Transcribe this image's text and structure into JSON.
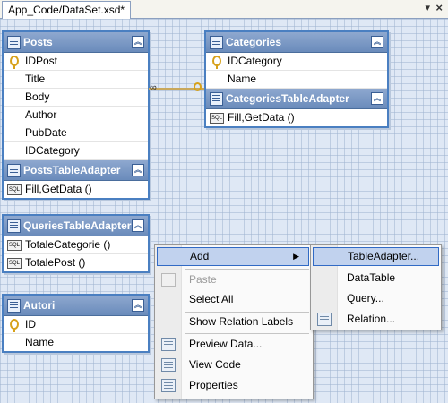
{
  "tab": {
    "title": "App_Code/DataSet.xsd*",
    "menu_icon": "chevron-down-icon",
    "close_icon": "close-icon"
  },
  "posts": {
    "title": "Posts",
    "columns": [
      "IDPost",
      "Title",
      "Body",
      "Author",
      "PubDate",
      "IDCategory"
    ],
    "adapter": {
      "title": "PostsTableAdapter",
      "methods": [
        "Fill,GetData ()"
      ]
    }
  },
  "categories": {
    "title": "Categories",
    "columns": [
      "IDCategory",
      "Name"
    ],
    "adapter": {
      "title": "CategoriesTableAdapter",
      "methods": [
        "Fill,GetData ()"
      ]
    }
  },
  "queries_adapter": {
    "title": "QueriesTableAdapter",
    "methods": [
      "TotaleCategorie ()",
      "TotalePost ()"
    ]
  },
  "autori": {
    "title": "Autori",
    "columns": [
      "ID",
      "Name"
    ]
  },
  "context_menu": {
    "items": [
      "Add",
      "Paste",
      "Select All",
      "Show Relation Labels",
      "Preview Data...",
      "View Code",
      "Properties"
    ]
  },
  "submenu": {
    "items": [
      "TableAdapter...",
      "DataTable",
      "Query...",
      "Relation..."
    ]
  },
  "colors": {
    "header": "#6a8bbb",
    "border": "#4a7fc1",
    "highlight": "#c1d2ee"
  }
}
